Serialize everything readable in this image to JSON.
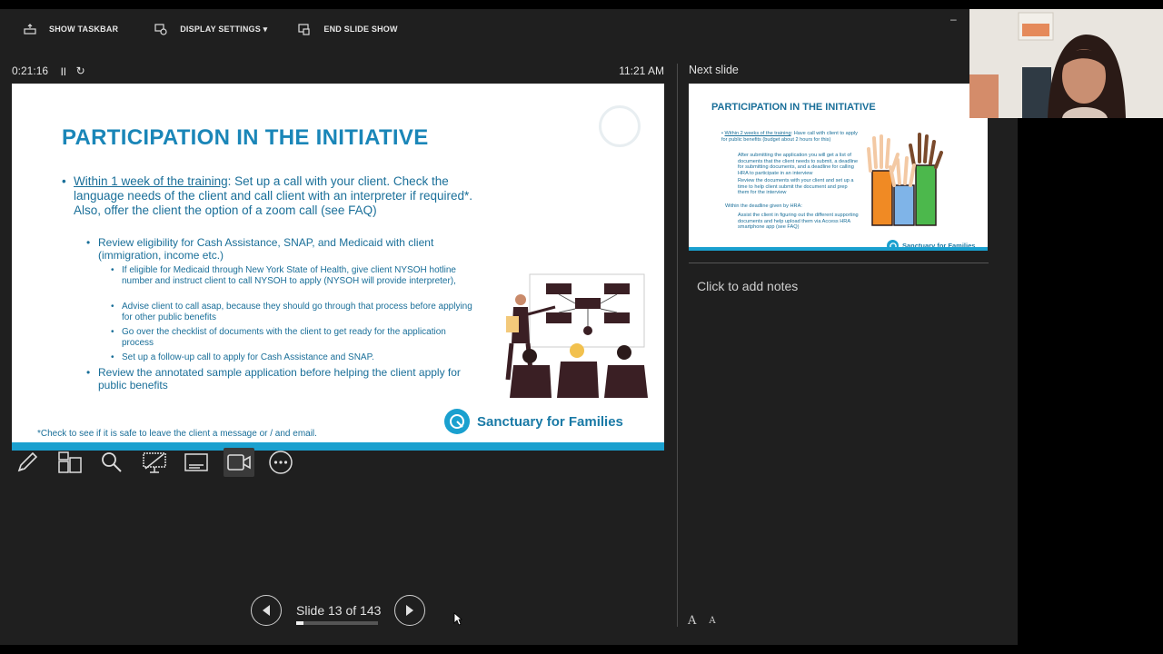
{
  "toolbar": {
    "show_taskbar": "SHOW TASKBAR",
    "display_settings": "DISPLAY SETTINGS ▾",
    "end_slide_show": "END SLIDE SHOW"
  },
  "timer": {
    "elapsed": "0:21:16",
    "clock": "11:21 AM"
  },
  "slide": {
    "title": "PARTICIPATION IN THE INITIATIVE",
    "bullet1_link": "Within 1 week of the training",
    "bullet1_rest": ":  Set up a call with your client. Check the language needs of the client and call client with an interpreter if required*. Also, offer the client the option of a zoom call (see FAQ)",
    "sub1": "Review eligibility for Cash Assistance, SNAP, and Medicaid with client (immigration, income etc.)",
    "sub1a": "If eligible for Medicaid through New York State of Health, give client NYSOH hotline number and instruct client to call NYSOH to apply (NYSOH will provide interpreter),",
    "sub1b": "Advise client to call asap, because they should go through that process before applying for other public benefits",
    "sub1c": "Go over the checklist of documents with the client to get ready for the application process",
    "sub1d": "Set up a follow-up call to apply for Cash Assistance and SNAP.",
    "sub2": "Review the annotated sample application before helping the client apply for public benefits",
    "footnote": "*Check to see if it is safe to leave the client a message or / and email.",
    "brand": "Sanctuary for Families"
  },
  "navigation": {
    "slide_counter": "Slide 13 of 143",
    "current": 13,
    "total": 143
  },
  "next_slide": {
    "label": "Next slide",
    "title": "PARTICIPATION IN THE INITIATIVE",
    "b1_link": "Within 2 weeks of the training",
    "b1_rest": ":  Have call with client to apply for public benefits (budget about 2 hours for this)",
    "b1a": "After submitting the application you will get a list of documents that the client needs to submit, a deadline for submitting documents, and a deadline for calling HRA to participate in an interview",
    "b1b": "Review the documents with your client and set up a time to help client submit the document and prep them for the interview",
    "b2": "Within the deadline given by HRA:",
    "b2a": "Assist the client in figuring out the different supporting documents and help upload them via Access HRA smartphone app (see FAQ)",
    "brand": "Sanctuary for Families"
  },
  "notes": {
    "placeholder": "Click to add notes"
  },
  "font_buttons": {
    "increase": "A",
    "decrease": "A"
  },
  "icons": [
    "taskbar-icon",
    "display-icon",
    "end-show-icon",
    "pause-icon",
    "reset-icon",
    "pen-icon",
    "all-slides-icon",
    "zoom-icon",
    "black-screen-icon",
    "subtitles-icon",
    "camera-icon",
    "more-options-icon",
    "previous-icon",
    "next-icon"
  ]
}
